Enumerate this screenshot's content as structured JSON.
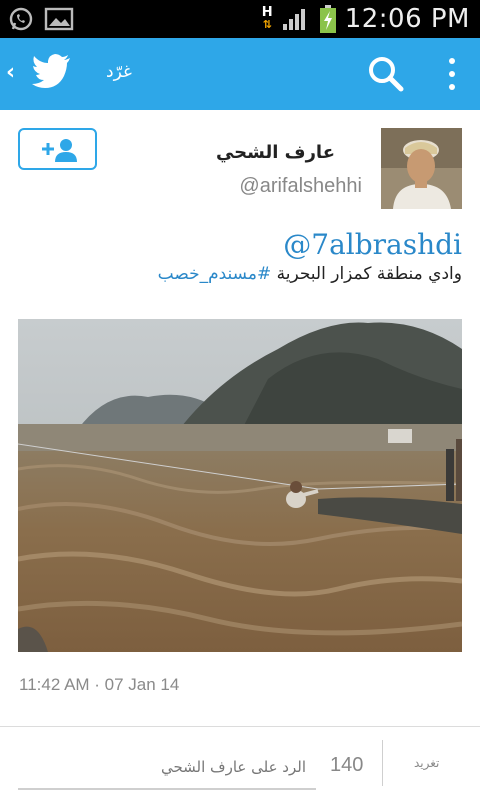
{
  "status_bar": {
    "time": "12:06 PM",
    "network": "H",
    "icons": [
      "whatsapp-icon",
      "gallery-icon",
      "network-arrows-icon",
      "signal-icon",
      "battery-charging-icon"
    ]
  },
  "app_bar": {
    "title": "غرّد",
    "accent_color": "#2ea7e8",
    "icons": [
      "back-chevron-icon",
      "twitter-bird-icon",
      "search-icon",
      "overflow-menu-icon"
    ]
  },
  "tweet": {
    "author_name": "عارف الشحي",
    "author_handle": "@arifalshehhi",
    "mention": "@7albrashdi",
    "text_prefix": "وادي منطقة كمزار البحرية ",
    "hashtag": "#مسندم_خصب",
    "timestamp": "11:42 AM · 07 Jan 14",
    "follow_icon": "add-user-icon",
    "link_color": "#2a88c9"
  },
  "reply_bar": {
    "placeholder": "الرد على عارف الشحي",
    "char_count": "140",
    "tweet_button": "تغريد"
  }
}
